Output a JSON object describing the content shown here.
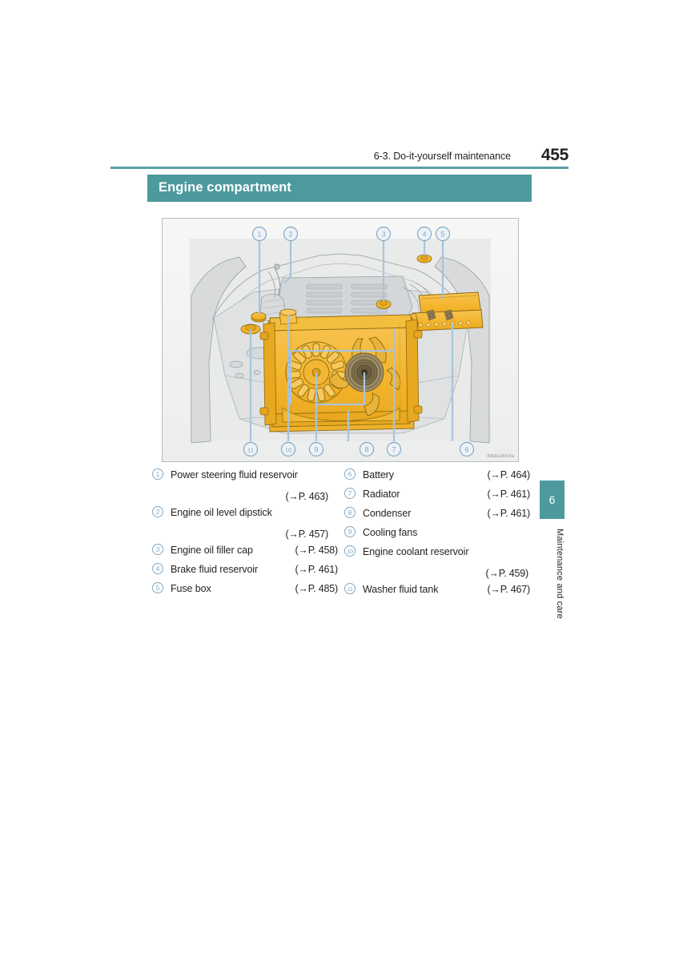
{
  "header": {
    "chapter_title": "6-3. Do-it-yourself maintenance",
    "page_number": "455"
  },
  "section": {
    "title": "Engine compartment"
  },
  "illustration": {
    "caption_code": "IN6&G4014a",
    "alt": "Top view of an engine compartment with radiator, cooling fans, condenser, battery and fuse box highlighted in orange",
    "callouts_top": [
      "1",
      "2",
      "3",
      "4",
      "5"
    ],
    "callouts_bottom": [
      "11",
      "10",
      "9",
      "8",
      "7",
      "6"
    ],
    "highlight_color": "#f5b731",
    "leader_color": "#a8c4dc",
    "body_color": "#d7d9da"
  },
  "legend": {
    "left": [
      {
        "num": "1",
        "label": "Power steering fluid reservoir",
        "ref": "(→P. 463)",
        "ref_on_own_line": true
      },
      {
        "num": "2",
        "label": "Engine oil level dipstick",
        "ref": "(→P. 457)",
        "ref_on_own_line": true
      },
      {
        "num": "3",
        "label": "Engine oil filler cap",
        "ref": "(→P. 458)",
        "ref_on_own_line": false
      },
      {
        "num": "4",
        "label": "Brake fluid reservoir",
        "ref": "(→P. 461)",
        "ref_on_own_line": false
      },
      {
        "num": "5",
        "label": "Fuse box",
        "ref": "(→P. 485)",
        "ref_on_own_line": false
      }
    ],
    "right": [
      {
        "num": "6",
        "label": "Battery",
        "ref": "(→P. 464)",
        "ref_on_own_line": false
      },
      {
        "num": "7",
        "label": "Radiator",
        "ref": "(→P. 461)",
        "ref_on_own_line": false
      },
      {
        "num": "8",
        "label": "Condenser",
        "ref": "(→P. 461)",
        "ref_on_own_line": false
      },
      {
        "num": "9",
        "label": "Cooling fans",
        "ref": "",
        "ref_on_own_line": false
      },
      {
        "num": "10",
        "label": "Engine coolant reservoir",
        "ref": "(→P. 459)",
        "ref_on_own_line": true
      },
      {
        "num": "11",
        "label": "Washer fluid tank",
        "ref": "(→P. 467)",
        "ref_on_own_line": false
      }
    ]
  },
  "side_tab": {
    "number": "6",
    "label": "Maintenance and care",
    "color": "#4d9a9e"
  },
  "theme": {
    "accent": "#4d9a9e",
    "rule": "#5aa0a4",
    "callout_blue": "#7fa9c6",
    "text": "#231f20"
  }
}
